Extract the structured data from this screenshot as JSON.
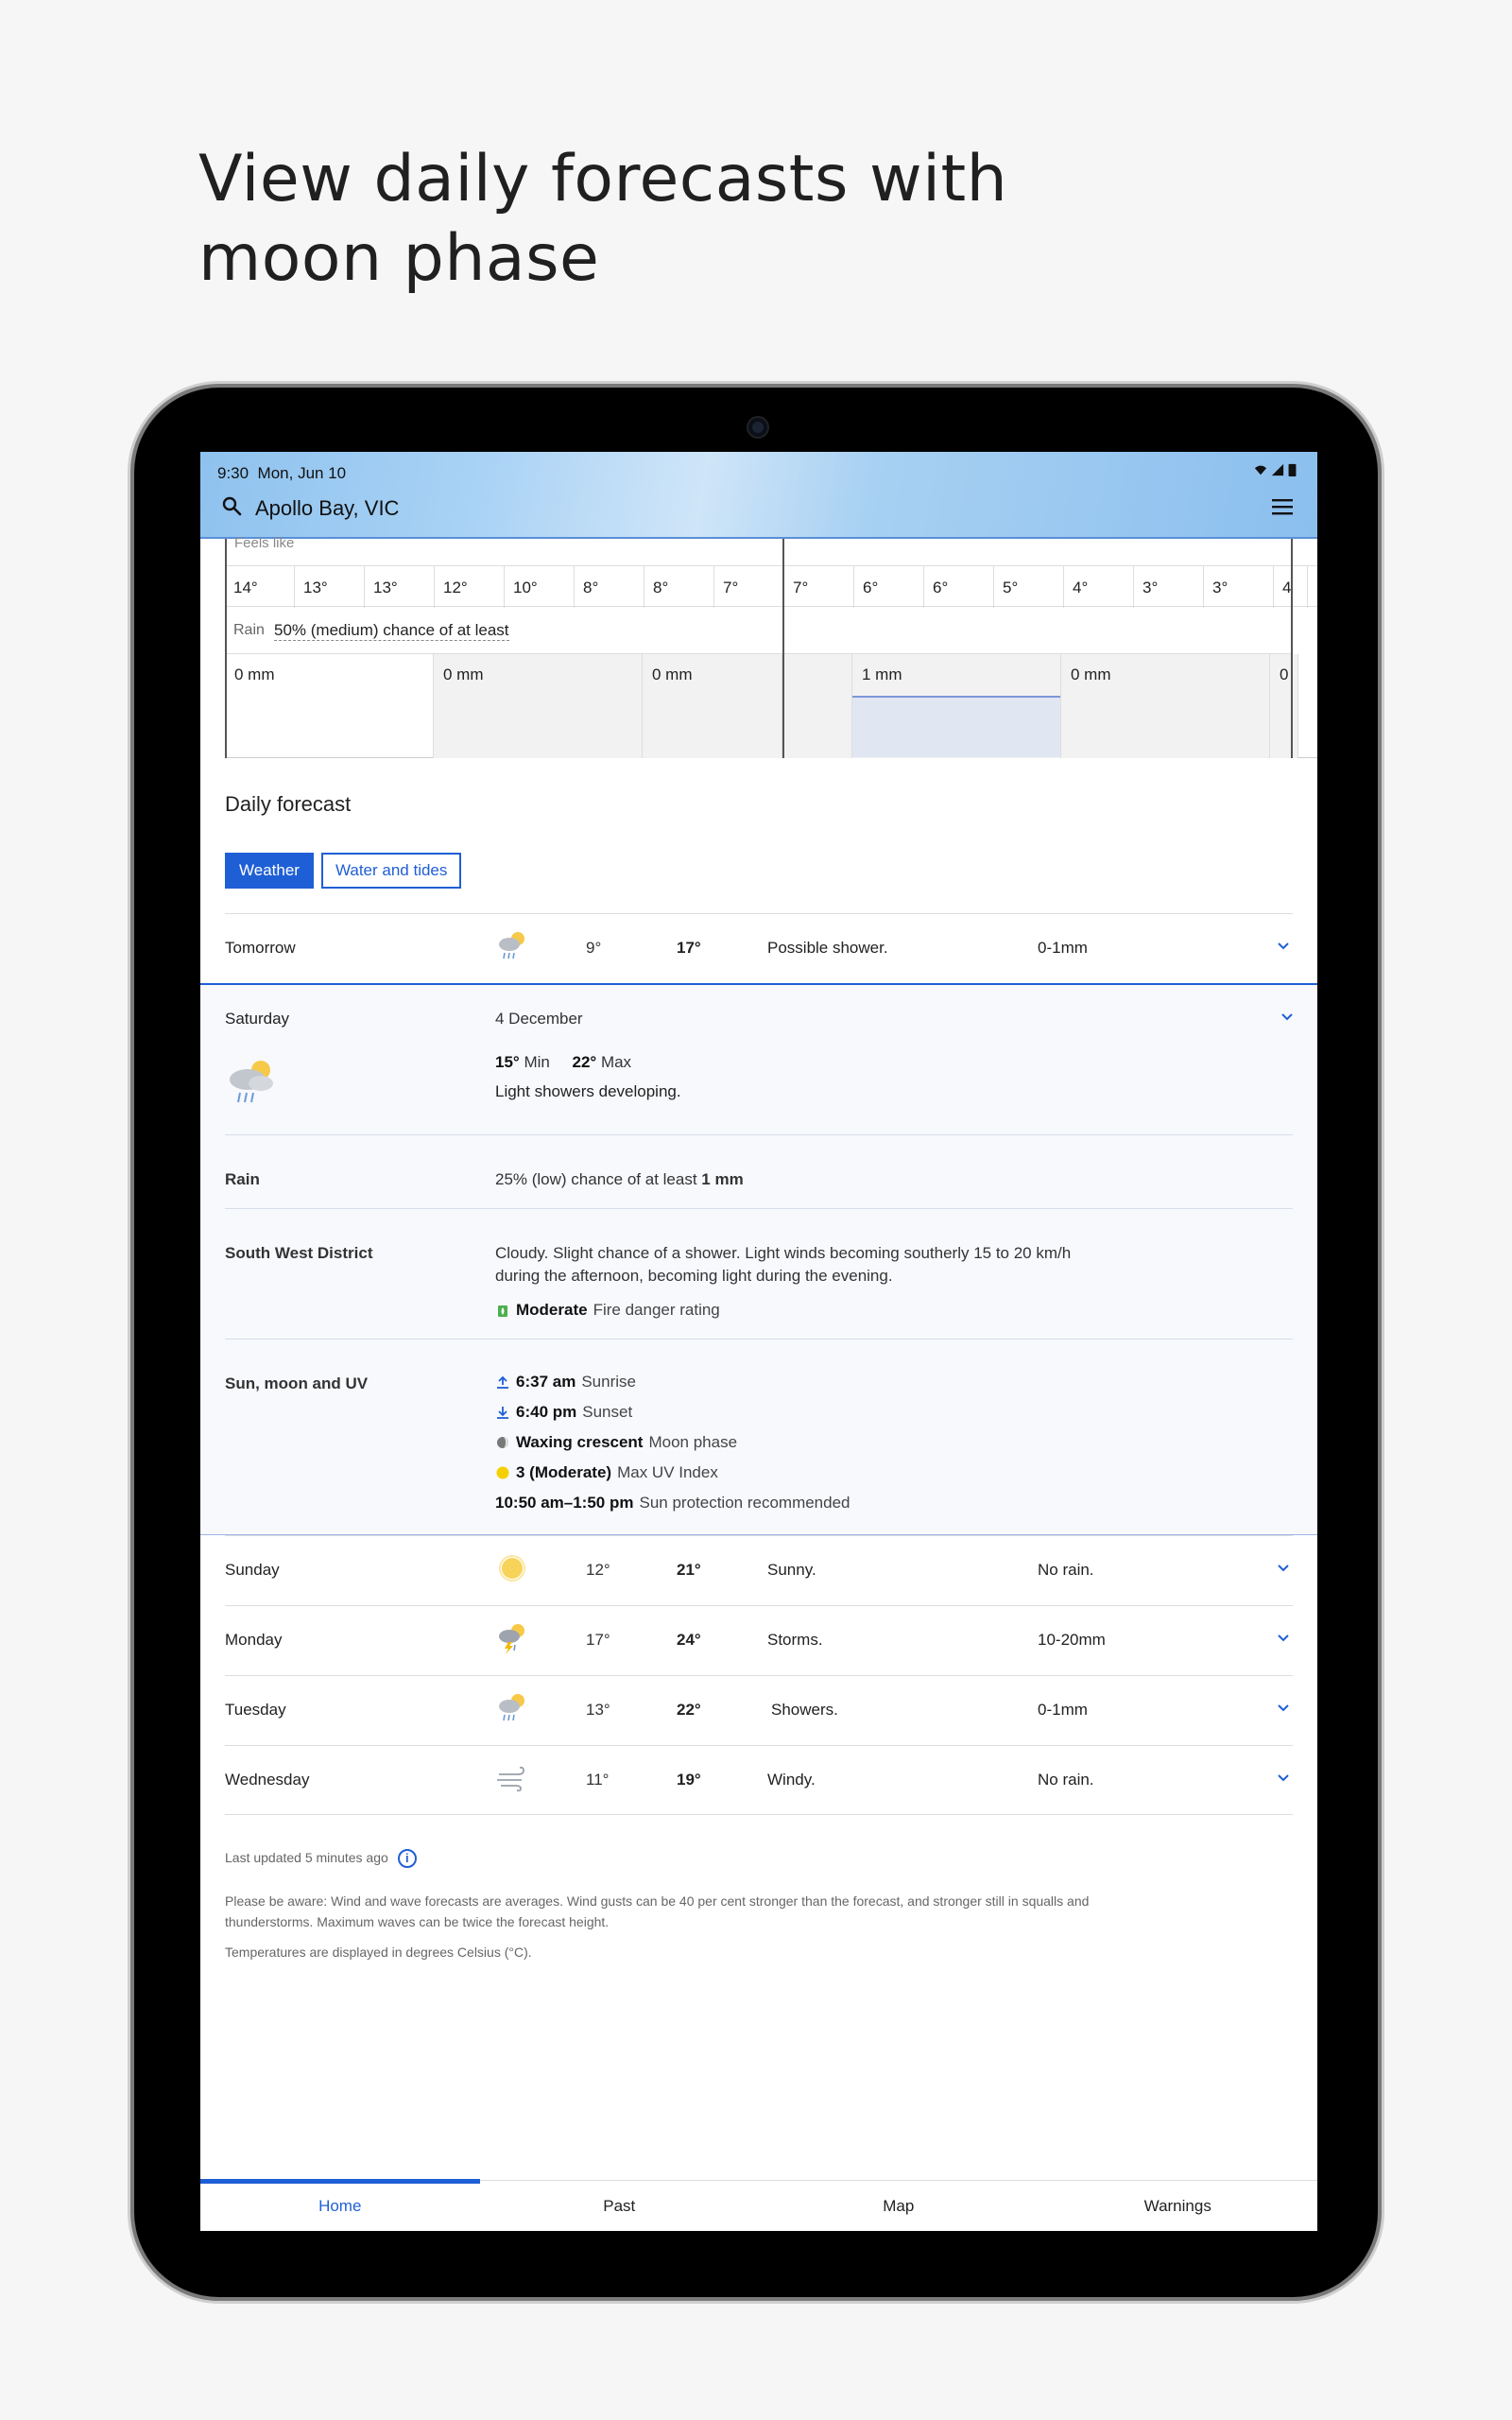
{
  "headline": "View daily forecasts with moon phase",
  "status": {
    "time": "9:30",
    "date": "Mon, Jun 10"
  },
  "header": {
    "location": "Apollo Bay, VIC"
  },
  "hourly": {
    "feels_like_label": "Feels like",
    "temps": [
      "14°",
      "13°",
      "13°",
      "12°",
      "10°",
      "8°",
      "8°",
      "7°",
      "7°",
      "6°",
      "6°",
      "5°",
      "4°",
      "3°",
      "3°",
      "4"
    ],
    "rain_label": "Rain",
    "rain_chance": "50% (medium) chance of at least",
    "rain_amounts": [
      "0 mm",
      "0 mm",
      "0 mm",
      "1 mm",
      "0 mm",
      "0"
    ]
  },
  "daily": {
    "title": "Daily forecast",
    "tab_weather": "Weather",
    "tab_water": "Water and tides",
    "tomorrow": {
      "day": "Tomorrow",
      "min": "9°",
      "max": "17°",
      "desc": "Possible shower.",
      "rain": "0-1mm",
      "icon": "shower-sun-icon"
    },
    "expanded": {
      "day": "Saturday",
      "date": "4 December",
      "min": "15°",
      "min_label": "Min",
      "max": "22°",
      "max_label": "Max",
      "summary": "Light showers developing.",
      "rain_label": "Rain",
      "rain_text": "25% (low) chance of at least",
      "rain_amount": "1 mm",
      "district_label": "South West District",
      "district_text_1": "Cloudy. Slight chance of a shower. Light winds becoming southerly 15 to 20 km/h",
      "district_text_2": "during the afternoon, becoming light during the evening.",
      "fire_rating": "Moderate",
      "fire_label": "Fire danger rating",
      "sun_label": "Sun, moon and UV",
      "sunrise_time": "6:37 am",
      "sunrise_label": "Sunrise",
      "sunset_time": "6:40 pm",
      "sunset_label": "Sunset",
      "moon": "Waxing crescent",
      "moon_label": "Moon phase",
      "uv": "3 (Moderate)",
      "uv_label": "Max UV Index",
      "protection_time": "10:50 am–1:50 pm",
      "protection_label": "Sun protection recommended"
    },
    "rows": [
      {
        "day": "Sunday",
        "min": "12°",
        "max": "21°",
        "desc": "Sunny.",
        "rain": "No rain.",
        "icon": "sun-icon"
      },
      {
        "day": "Monday",
        "min": "17°",
        "max": "24°",
        "desc": "Storms.",
        "rain": "10-20mm",
        "icon": "storm-icon"
      },
      {
        "day": "Tuesday",
        "min": "13°",
        "max": "22°",
        "desc": "Showers.",
        "rain": "0-1mm",
        "icon": "shower-sun-icon"
      },
      {
        "day": "Wednesday",
        "min": "11°",
        "max": "19°",
        "desc": "Windy.",
        "rain": "No rain.",
        "icon": "wind-icon"
      }
    ]
  },
  "footer": {
    "updated": "Last updated 5 minutes ago",
    "note_1": "Please be aware: Wind and wave forecasts are averages. Wind gusts can be 40 per cent stronger than the forecast, and stronger still in squalls and",
    "note_2": "thunderstorms. Maximum waves can be twice the forecast height.",
    "note_3": "Temperatures are displayed in degrees Celsius (°C)."
  },
  "nav": {
    "home": "Home",
    "past": "Past",
    "map": "Map",
    "warnings": "Warnings"
  },
  "colors": {
    "accent": "#1f5fd6",
    "expanded_bg": "#f7f9fd",
    "rain_bar": "#e1e6f3"
  }
}
